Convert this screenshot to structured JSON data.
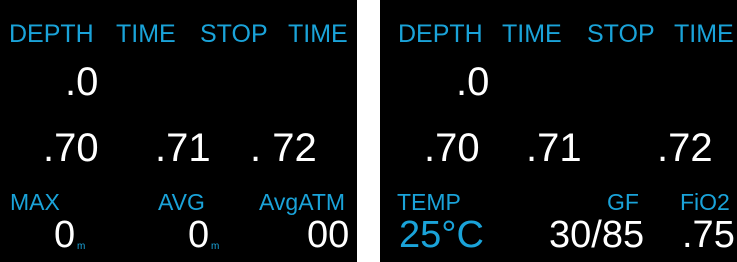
{
  "colors": {
    "background": "#000000",
    "label": "#1aa3d9",
    "value": "#ffffff"
  },
  "left_screen": {
    "header": [
      "DEPTH",
      "TIME",
      "STOP",
      "TIME"
    ],
    "depth": ".0",
    "stop_values": [
      ".70",
      ".71",
      ". 72"
    ],
    "footer_labels": [
      "MAX",
      "AVG",
      "AvgATM"
    ],
    "max_value": "0",
    "max_unit": "m",
    "avg_value": "0",
    "avg_unit": "m",
    "avgatm_value": "00"
  },
  "right_screen": {
    "header": [
      "DEPTH",
      "TIME",
      "STOP",
      "TIME"
    ],
    "depth": ".0",
    "stop_values": [
      ".70",
      ".71",
      ".72"
    ],
    "footer_labels": [
      "TEMP",
      "GF",
      "FiO2"
    ],
    "temp_value": "25°C",
    "gf_value": "30/85",
    "fio2_value": ".75"
  }
}
